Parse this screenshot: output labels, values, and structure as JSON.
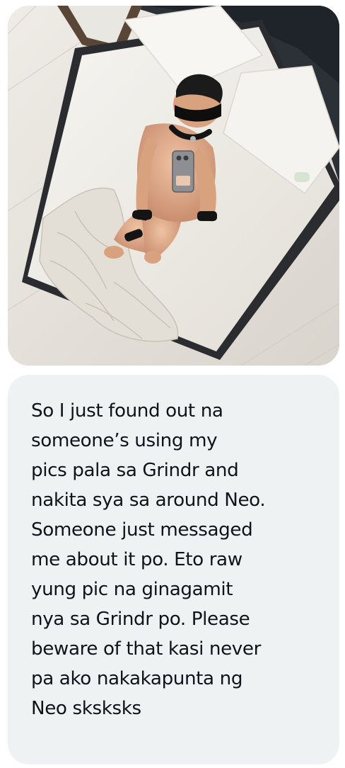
{
  "message": {
    "image_alt": "Mirror selfie of a person blindfolded on a bed",
    "text_lines": [
      "So I just found out na",
      "someone’s using my",
      "pics pala sa Grindr and",
      "nakita sya sa around Neo.",
      "Someone just messaged",
      "me about it po. Eto raw",
      "yung pic na ginagamit",
      "nya sa Grindr po. Please",
      "beware of that kasi never",
      "pa ako nakakapunta ng",
      "Neo sksksks"
    ]
  },
  "colors": {
    "bubble_background": "#eef2f3",
    "text": "#0f1419",
    "page_background": "#ffffff"
  }
}
